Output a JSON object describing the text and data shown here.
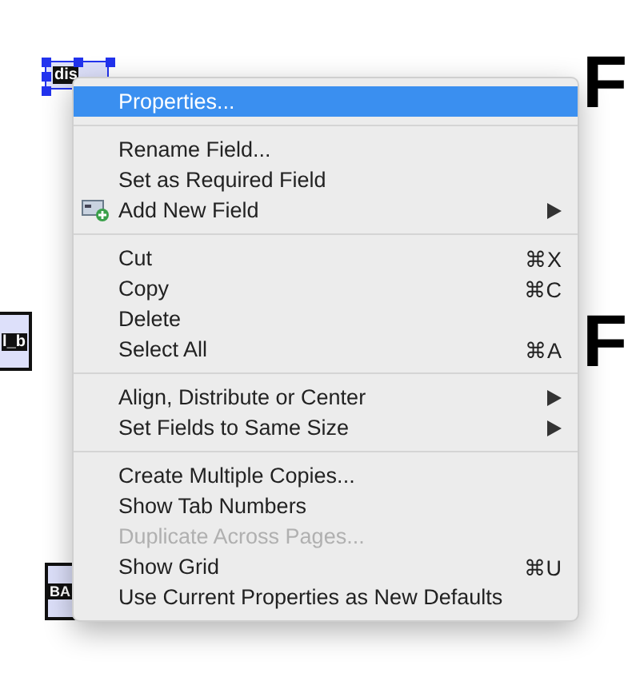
{
  "canvas": {
    "fields": [
      {
        "label": "dis",
        "selected": true
      },
      {
        "label": "l_b",
        "selected": false
      },
      {
        "label": "BA",
        "selected": false
      }
    ],
    "headings": [
      "F",
      "F"
    ]
  },
  "context_menu": {
    "groups": [
      [
        {
          "label": "Properties...",
          "selected": true,
          "disabled": false
        }
      ],
      [
        {
          "label": "Rename Field...",
          "selected": false,
          "disabled": false
        },
        {
          "label": "Set as Required Field",
          "selected": false,
          "disabled": false
        },
        {
          "label": "Add New Field",
          "selected": false,
          "disabled": false,
          "icon": true,
          "submenu": true
        }
      ],
      [
        {
          "label": "Cut",
          "selected": false,
          "disabled": false,
          "shortcut": "⌘X"
        },
        {
          "label": "Copy",
          "selected": false,
          "disabled": false,
          "shortcut": "⌘C"
        },
        {
          "label": "Delete",
          "selected": false,
          "disabled": false
        },
        {
          "label": "Select All",
          "selected": false,
          "disabled": false,
          "shortcut": "⌘A"
        }
      ],
      [
        {
          "label": "Align, Distribute or Center",
          "selected": false,
          "disabled": false,
          "submenu": true
        },
        {
          "label": "Set Fields to Same Size",
          "selected": false,
          "disabled": false,
          "submenu": true
        }
      ],
      [
        {
          "label": "Create Multiple Copies...",
          "selected": false,
          "disabled": false
        },
        {
          "label": "Show Tab Numbers",
          "selected": false,
          "disabled": false
        },
        {
          "label": "Duplicate Across Pages...",
          "selected": false,
          "disabled": true
        },
        {
          "label": "Show Grid",
          "selected": false,
          "disabled": false,
          "shortcut": "⌘U"
        },
        {
          "label": "Use Current Properties as New Defaults",
          "selected": false,
          "disabled": false
        }
      ]
    ]
  }
}
